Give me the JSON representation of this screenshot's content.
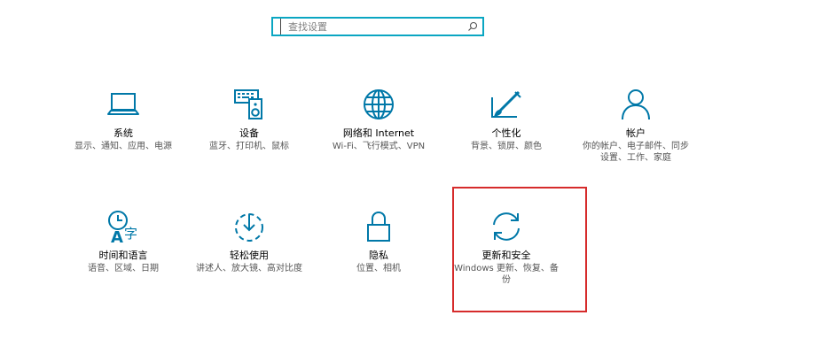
{
  "search": {
    "placeholder": "查找设置"
  },
  "colors": {
    "accent": "#0078a8",
    "search_border": "#0aa6c2",
    "highlight": "#d62b2b"
  },
  "tiles": [
    {
      "title": "系统",
      "desc": "显示、通知、应用、电源",
      "icon": "laptop-icon"
    },
    {
      "title": "设备",
      "desc": "蓝牙、打印机、鼠标",
      "icon": "keyboard-speaker-icon"
    },
    {
      "title": "网络和 Internet",
      "desc": "Wi-Fi、飞行模式、VPN",
      "icon": "globe-icon"
    },
    {
      "title": "个性化",
      "desc": "背景、锁屏、颜色",
      "icon": "paint-brush-icon"
    },
    {
      "title": "帐户",
      "desc": "你的帐户、电子邮件、同步设置、工作、家庭",
      "icon": "person-icon"
    },
    {
      "title": "时间和语言",
      "desc": "语音、区域、日期",
      "icon": "time-language-icon"
    },
    {
      "title": "轻松使用",
      "desc": "讲述人、放大镜、高对比度",
      "icon": "ease-of-access-icon"
    },
    {
      "title": "隐私",
      "desc": "位置、相机",
      "icon": "lock-icon"
    },
    {
      "title": "更新和安全",
      "desc": "Windows 更新、恢复、备份",
      "icon": "sync-icon"
    }
  ]
}
